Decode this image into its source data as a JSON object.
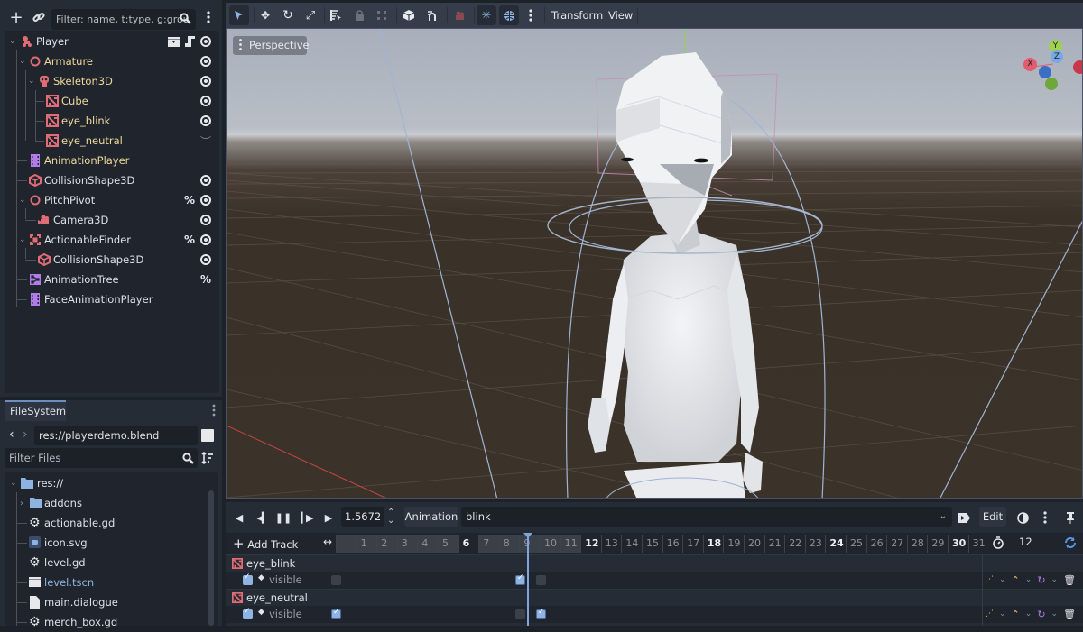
{
  "scene_dock": {
    "toolbar": {
      "add_icon": "plus-icon",
      "link_icon": "link-icon",
      "filter_placeholder": "Filter: name, t:type, g:grou",
      "search_icon": "search-icon",
      "menu_icon": "kebab-menu-icon"
    },
    "nodes": [
      {
        "label": "Player",
        "icon": "character-body-icon",
        "color": "yellow-off",
        "expanded": true,
        "right": [
          "clapper-icon",
          "script-icon",
          "eye-icon"
        ]
      },
      {
        "label": "Armature",
        "icon": "node3d-icon",
        "color": "yellow",
        "expanded": true,
        "right": [
          "eye-icon"
        ]
      },
      {
        "label": "Skeleton3D",
        "icon": "skeleton-icon",
        "color": "yellow",
        "expanded": true,
        "right": [
          "eye-icon"
        ]
      },
      {
        "label": "Cube",
        "icon": "mesh-instance-icon",
        "color": "yellow",
        "right": [
          "eye-icon"
        ]
      },
      {
        "label": "eye_blink",
        "icon": "mesh-instance-icon",
        "color": "yellow",
        "right": [
          "eye-icon"
        ]
      },
      {
        "label": "eye_neutral",
        "icon": "mesh-instance-icon",
        "color": "yellow",
        "right": [
          "eye-closed-icon"
        ]
      },
      {
        "label": "AnimationPlayer",
        "icon": "animation-player-icon",
        "color": "yellow",
        "right": []
      },
      {
        "label": "CollisionShape3D",
        "icon": "collision-shape-icon",
        "color": "white",
        "right": [
          "eye-icon"
        ]
      },
      {
        "label": "PitchPivot",
        "icon": "node3d-icon",
        "color": "white",
        "expanded": true,
        "right": [
          "percent-icon",
          "eye-icon"
        ]
      },
      {
        "label": "Camera3D",
        "icon": "camera-icon",
        "color": "white",
        "right": [
          "eye-icon"
        ]
      },
      {
        "label": "ActionableFinder",
        "icon": "area3d-icon",
        "color": "white",
        "expanded": true,
        "right": [
          "percent-icon",
          "eye-icon"
        ]
      },
      {
        "label": "CollisionShape3D",
        "icon": "collision-shape-icon",
        "color": "white",
        "right": [
          "eye-icon"
        ]
      },
      {
        "label": "AnimationTree",
        "icon": "animation-tree-icon",
        "color": "white",
        "right": [
          "percent-icon"
        ]
      },
      {
        "label": "FaceAnimationPlayer",
        "icon": "animation-player-icon",
        "color": "white",
        "right": []
      }
    ]
  },
  "filesystem": {
    "tab_label": "FileSystem",
    "path": "res://playerdemo.blend",
    "filter_placeholder": "Filter Files",
    "items": [
      {
        "label": "res://",
        "icon": "folder-icon",
        "expanded": true
      },
      {
        "label": "addons",
        "icon": "folder-icon",
        "collapsed": true
      },
      {
        "label": "actionable.gd",
        "icon": "gear-script-icon"
      },
      {
        "label": "icon.svg",
        "icon": "godot-image-icon"
      },
      {
        "label": "level.gd",
        "icon": "gear-script-icon"
      },
      {
        "label": "level.tscn",
        "icon": "scene-clapper-icon",
        "highlight": true
      },
      {
        "label": "main.dialogue",
        "icon": "file-icon"
      },
      {
        "label": "merch_box.gd",
        "icon": "gear-script-icon"
      }
    ]
  },
  "main_toolbar": {
    "tools": [
      "select-tool-icon",
      "move-tool-icon",
      "rotate-tool-icon",
      "scale-tool-icon",
      "list-select-icon",
      "lock-icon",
      "group-icon",
      "local-space-icon",
      "snap-icon",
      "camera-preview-icon",
      "sun-preview-icon",
      "environment-preview-icon",
      "more-icon"
    ],
    "menus": [
      "Transform",
      "View"
    ]
  },
  "viewport": {
    "mode_label": "Perspective",
    "gizmo_axes": {
      "x": "X",
      "y": "Y",
      "z": "Z"
    },
    "colors": {
      "sky_top": "#aeb4bf",
      "horizon": "#c9ccd1",
      "ground": "#3b3129",
      "x_axis": "#e05c6e",
      "y_axis": "#9ed14f",
      "z_axis": "#5c94e0"
    }
  },
  "animation": {
    "time": "1.5672",
    "label": "Animation",
    "current": "blink",
    "edit_label": "Edit",
    "add_track_label": "Add Track",
    "snap_value": "12",
    "timeline_ticks": [
      "1",
      "2",
      "3",
      "4",
      "5",
      "6",
      "7",
      "8",
      "9",
      "10",
      "11",
      "12",
      "13",
      "14",
      "15",
      "16",
      "17",
      "18",
      "19",
      "20",
      "21",
      "22",
      "23",
      "24",
      "25",
      "26",
      "27",
      "28",
      "29",
      "30",
      "31"
    ],
    "bold_ticks": [
      "6",
      "12",
      "18",
      "24",
      "30"
    ],
    "playhead_frame": 9,
    "tracks": [
      {
        "node": "eye_blink",
        "property": "visible",
        "keys": [
          {
            "frame": 0,
            "value": false
          },
          {
            "frame": 9,
            "value": true
          },
          {
            "frame": 10,
            "value": false
          }
        ]
      },
      {
        "node": "eye_neutral",
        "property": "visible",
        "keys": [
          {
            "frame": 0,
            "value": true
          },
          {
            "frame": 9,
            "value": false
          },
          {
            "frame": 10,
            "value": true
          }
        ]
      }
    ]
  }
}
